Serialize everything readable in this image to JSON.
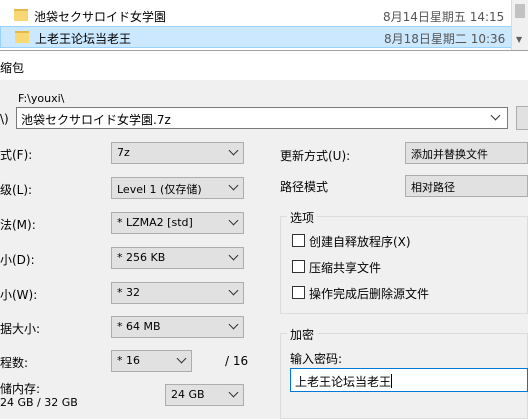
{
  "explorer": {
    "rows": [
      {
        "name": "池袋セクサロイド女学園",
        "date": "8月14日星期五 14:15"
      },
      {
        "name": "上老王论坛当老王",
        "date": "8月18日星期二 10:36"
      }
    ]
  },
  "dialog": {
    "title": "缩包",
    "archive_label": "\\)",
    "archive_dir": "F:\\youxi\\",
    "archive_path": "池袋セクサロイド女学園.7z"
  },
  "left": {
    "format": {
      "label": "式(F):",
      "value": "7z"
    },
    "level": {
      "label": "级(L):",
      "value": "Level 1 (仅存储)"
    },
    "method": {
      "label": "法(M):",
      "value": "* LZMA2 [std]"
    },
    "dict": {
      "label": "小(D):",
      "value": "* 256 KB"
    },
    "word": {
      "label": "小(W):",
      "value": "* 32"
    },
    "solid": {
      "label": "据大小:",
      "value": "* 64 MB"
    },
    "threads": {
      "label": "程数:",
      "value": "* 16",
      "max": "/ 16"
    },
    "memory": {
      "label": "储内存:",
      "sub": "24 GB / 32 GB",
      "value": "24 GB"
    }
  },
  "right": {
    "update": {
      "label": "更新方式(U):",
      "value": "添加并替换文件"
    },
    "path": {
      "label": "路径模式",
      "value": "相对路径"
    },
    "options": {
      "title": "选项",
      "items": [
        "创建自释放程序(X)",
        "压缩共享文件",
        "操作完成后删除源文件"
      ]
    },
    "encryption": {
      "title": "加密",
      "pwd_label": "输入密码:",
      "pwd_value": "上老王论坛当老王"
    }
  }
}
